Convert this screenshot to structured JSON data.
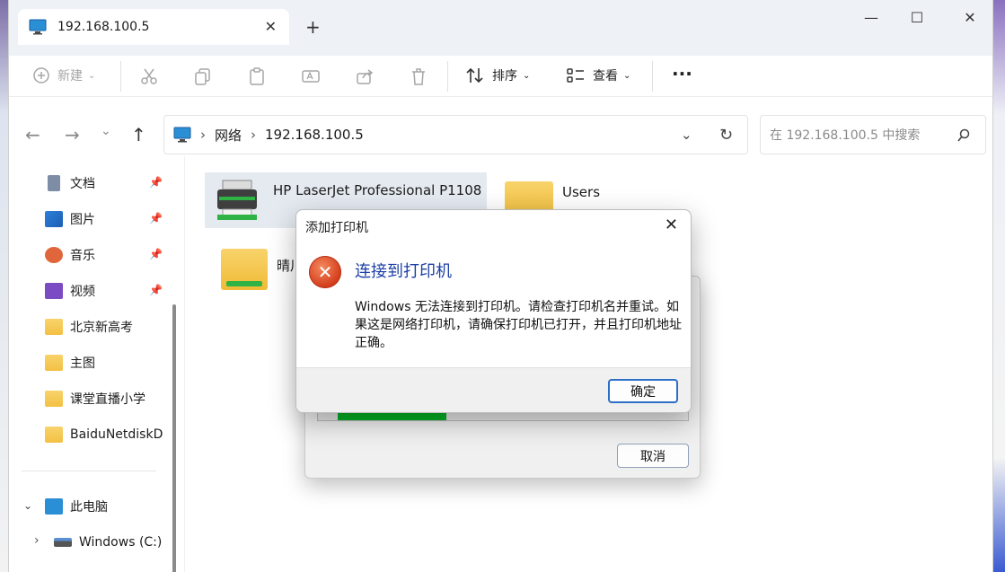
{
  "window": {
    "tab_title": "192.168.100.5",
    "tab_close": "✕",
    "new_tab": "+",
    "minimize": "—",
    "maximize": "☐",
    "close": "✕"
  },
  "toolbar": {
    "new_label": "新建",
    "sort_label": "排序",
    "view_label": "查看",
    "more_label": "···"
  },
  "address": {
    "crumbs": [
      "网络",
      "192.168.100.5"
    ],
    "search_placeholder": "在 192.168.100.5 中搜索"
  },
  "sidebar": {
    "pinned": [
      {
        "label": "文档",
        "icon": "document-icon"
      },
      {
        "label": "图片",
        "icon": "pictures-icon"
      },
      {
        "label": "音乐",
        "icon": "music-icon"
      },
      {
        "label": "视频",
        "icon": "video-icon"
      }
    ],
    "folders": [
      "北京新高考",
      "主图",
      "课堂直播小学",
      "BaiduNetdiskD"
    ],
    "this_pc": "此电脑",
    "drive": "Windows (C:)"
  },
  "content": {
    "printer": "HP LaserJet Professional P1108",
    "users": "Users",
    "partial": "晴川"
  },
  "back_dialog": {
    "cancel_label": "取消",
    "progress": 0.31
  },
  "dialog": {
    "title": "添加打印机",
    "heading": "连接到打印机",
    "message": "Windows 无法连接到打印机。请检查打印机名并重试。如果这是网络打印机，请确保打印机已打开，并且打印机地址正确。",
    "ok_label": "确定"
  }
}
